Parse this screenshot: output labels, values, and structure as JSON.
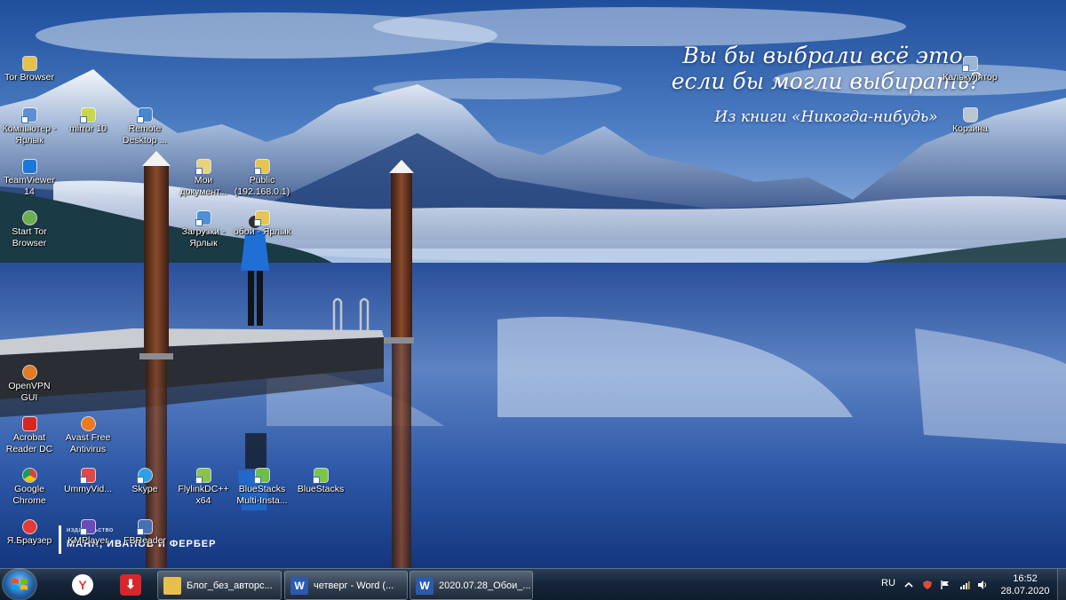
{
  "quote": {
    "line1": "Вы бы выбрали всё это,",
    "line2": "если бы могли выбирать?",
    "source": "Из книги «Никогда-нибудь»"
  },
  "publisher": {
    "small": "издательство",
    "big": "МАНН, ИВАНОВ И ФЕРБЕР"
  },
  "desktop_icons": [
    {
      "label": "Tor Browser",
      "icon": "onion-folder-icon",
      "color": "#e4c24a"
    },
    {
      "label": "Компьютер - Ярлык",
      "icon": "computer-icon",
      "color": "#5b8fd6"
    },
    {
      "label": "mirror 10",
      "icon": "mirror-icon",
      "color": "#c8d84a"
    },
    {
      "label": "Remote Desktop ...",
      "icon": "remote-desktop-icon",
      "color": "#4a86d0"
    },
    {
      "label": "TeamViewer 14",
      "icon": "teamviewer-icon",
      "color": "#1c78d8"
    },
    {
      "label": "Мои документ...",
      "icon": "documents-icon",
      "color": "#e8d27a"
    },
    {
      "label": "Public (192.168.0.1)",
      "icon": "network-folder-icon",
      "color": "#e7c64e"
    },
    {
      "label": "Start Tor Browser",
      "icon": "tor-globe-icon",
      "color": "#6bb04a"
    },
    {
      "label": "Загрузки - Ярлык",
      "icon": "downloads-icon",
      "color": "#4f8fd8"
    },
    {
      "label": "обои - Ярлык",
      "icon": "wallpaper-folder-icon",
      "color": "#e7c64e"
    },
    {
      "label": "OpenVPN GUI",
      "icon": "openvpn-icon",
      "color": "#e47a22"
    },
    {
      "label": "Acrobat Reader DC",
      "icon": "acrobat-icon",
      "color": "#d8261e"
    },
    {
      "label": "Avast Free Antivirus",
      "icon": "avast-icon",
      "color": "#f07a1a"
    },
    {
      "label": "Google Chrome",
      "icon": "chrome-icon",
      "color": "#3c9b48"
    },
    {
      "label": "UmmyVid...",
      "icon": "ummy-icon",
      "color": "#e24646"
    },
    {
      "label": "Skype",
      "icon": "skype-icon",
      "color": "#2aa2e6"
    },
    {
      "label": "FlylinkDC++ x64",
      "icon": "flylink-icon",
      "color": "#8bc34a"
    },
    {
      "label": "BlueStacks Multi-Insta...",
      "icon": "bluestacks-multi-icon",
      "color": "#6cc04a"
    },
    {
      "label": "BlueStacks",
      "icon": "bluestacks-icon",
      "color": "#7ac64a"
    },
    {
      "label": "Я.Браузер",
      "icon": "yandex-browser-icon",
      "color": "#e53935"
    },
    {
      "label": "KMPlayer",
      "icon": "kmplayer-icon",
      "color": "#6a4ab8"
    },
    {
      "label": "FBReader",
      "icon": "fbreader-icon",
      "color": "#4a6fb0"
    },
    {
      "label": "Калькулятор",
      "icon": "calculator-icon",
      "color": "#9ab6d6"
    },
    {
      "label": "Корзина",
      "icon": "recycle-bin-icon",
      "color": "#b9c6d4"
    }
  ],
  "taskbar": {
    "pinned": [
      {
        "name": "yandex-browser",
        "glyph": "Y",
        "color": "#ffffff",
        "text_color": "#e53935"
      },
      {
        "name": "download-manager",
        "glyph": "⬇",
        "color": "#d8262a",
        "text_color": "#ffffff"
      }
    ],
    "tasks": [
      {
        "label": "Блог_без_авторс...",
        "icon": "folder-icon",
        "glyph": "",
        "color": "#e6c04a"
      },
      {
        "label": "четверг - Word (...",
        "icon": "word-icon",
        "glyph": "W",
        "color": "#2b5bae"
      },
      {
        "label": "2020.07.28_Обои_...",
        "icon": "word-icon",
        "glyph": "W",
        "color": "#2b5bae"
      }
    ],
    "tray": {
      "language": "RU",
      "time": "16:52",
      "date": "28.07.2020"
    }
  }
}
